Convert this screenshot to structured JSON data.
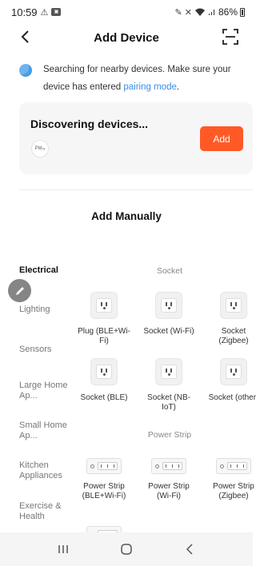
{
  "status_bar": {
    "time": "10:59",
    "battery_text": "86%"
  },
  "header": {
    "title": "Add Device"
  },
  "hint": {
    "text": "Searching for nearby devices. Make sure your device has entered ",
    "link": "pairing mode",
    "suffix": "."
  },
  "discover": {
    "title": "Discovering devices...",
    "chip_text": "PMₓₓ",
    "add_label": "Add"
  },
  "manual": {
    "title": "Add Manually"
  },
  "categories": [
    {
      "label": "Electrical",
      "active": true
    },
    {
      "label": "Lighting",
      "active": false
    },
    {
      "label": "Sensors",
      "active": false
    },
    {
      "label": "Large Home Ap...",
      "active": false
    },
    {
      "label": "Small Home Ap...",
      "active": false
    },
    {
      "label": "Kitchen Appliances",
      "active": false
    },
    {
      "label": "Exercise & Health",
      "active": false
    }
  ],
  "groups": {
    "socket": {
      "title": "Socket",
      "items": [
        {
          "label": "Plug (BLE+Wi-Fi)"
        },
        {
          "label": "Socket (Wi-Fi)"
        },
        {
          "label": "Socket (Zigbee)"
        },
        {
          "label": "Socket (BLE)"
        },
        {
          "label": "Socket (NB-IoT)"
        },
        {
          "label": "Socket (other)"
        }
      ]
    },
    "power_strip": {
      "title": "Power Strip",
      "items": [
        {
          "label": "Power Strip (BLE+Wi-Fi)"
        },
        {
          "label": "Power Strip (Wi-Fi)"
        },
        {
          "label": "Power Strip (Zigbee)"
        }
      ]
    }
  },
  "colors": {
    "accent": "#ff5a26",
    "link": "#3a8ee6"
  }
}
